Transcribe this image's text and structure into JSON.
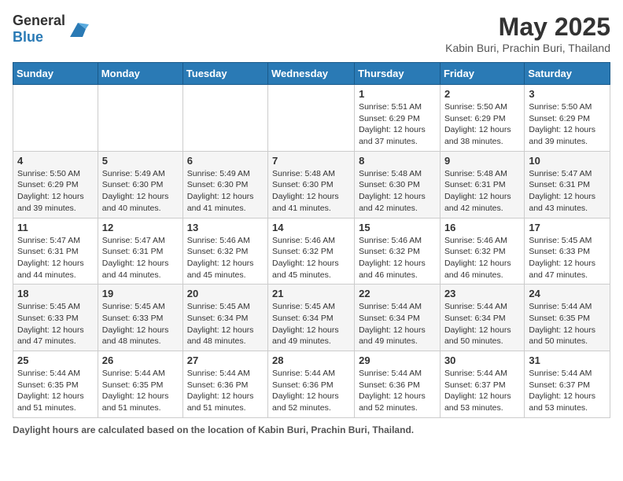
{
  "header": {
    "logo_general": "General",
    "logo_blue": "Blue",
    "title": "May 2025",
    "subtitle": "Kabin Buri, Prachin Buri, Thailand"
  },
  "days_of_week": [
    "Sunday",
    "Monday",
    "Tuesday",
    "Wednesday",
    "Thursday",
    "Friday",
    "Saturday"
  ],
  "weeks": [
    [
      {
        "day": "",
        "info": ""
      },
      {
        "day": "",
        "info": ""
      },
      {
        "day": "",
        "info": ""
      },
      {
        "day": "",
        "info": ""
      },
      {
        "day": "1",
        "info": "Sunrise: 5:51 AM\nSunset: 6:29 PM\nDaylight: 12 hours and 37 minutes."
      },
      {
        "day": "2",
        "info": "Sunrise: 5:50 AM\nSunset: 6:29 PM\nDaylight: 12 hours and 38 minutes."
      },
      {
        "day": "3",
        "info": "Sunrise: 5:50 AM\nSunset: 6:29 PM\nDaylight: 12 hours and 39 minutes."
      }
    ],
    [
      {
        "day": "4",
        "info": "Sunrise: 5:50 AM\nSunset: 6:29 PM\nDaylight: 12 hours and 39 minutes."
      },
      {
        "day": "5",
        "info": "Sunrise: 5:49 AM\nSunset: 6:30 PM\nDaylight: 12 hours and 40 minutes."
      },
      {
        "day": "6",
        "info": "Sunrise: 5:49 AM\nSunset: 6:30 PM\nDaylight: 12 hours and 41 minutes."
      },
      {
        "day": "7",
        "info": "Sunrise: 5:48 AM\nSunset: 6:30 PM\nDaylight: 12 hours and 41 minutes."
      },
      {
        "day": "8",
        "info": "Sunrise: 5:48 AM\nSunset: 6:30 PM\nDaylight: 12 hours and 42 minutes."
      },
      {
        "day": "9",
        "info": "Sunrise: 5:48 AM\nSunset: 6:31 PM\nDaylight: 12 hours and 42 minutes."
      },
      {
        "day": "10",
        "info": "Sunrise: 5:47 AM\nSunset: 6:31 PM\nDaylight: 12 hours and 43 minutes."
      }
    ],
    [
      {
        "day": "11",
        "info": "Sunrise: 5:47 AM\nSunset: 6:31 PM\nDaylight: 12 hours and 44 minutes."
      },
      {
        "day": "12",
        "info": "Sunrise: 5:47 AM\nSunset: 6:31 PM\nDaylight: 12 hours and 44 minutes."
      },
      {
        "day": "13",
        "info": "Sunrise: 5:46 AM\nSunset: 6:32 PM\nDaylight: 12 hours and 45 minutes."
      },
      {
        "day": "14",
        "info": "Sunrise: 5:46 AM\nSunset: 6:32 PM\nDaylight: 12 hours and 45 minutes."
      },
      {
        "day": "15",
        "info": "Sunrise: 5:46 AM\nSunset: 6:32 PM\nDaylight: 12 hours and 46 minutes."
      },
      {
        "day": "16",
        "info": "Sunrise: 5:46 AM\nSunset: 6:32 PM\nDaylight: 12 hours and 46 minutes."
      },
      {
        "day": "17",
        "info": "Sunrise: 5:45 AM\nSunset: 6:33 PM\nDaylight: 12 hours and 47 minutes."
      }
    ],
    [
      {
        "day": "18",
        "info": "Sunrise: 5:45 AM\nSunset: 6:33 PM\nDaylight: 12 hours and 47 minutes."
      },
      {
        "day": "19",
        "info": "Sunrise: 5:45 AM\nSunset: 6:33 PM\nDaylight: 12 hours and 48 minutes."
      },
      {
        "day": "20",
        "info": "Sunrise: 5:45 AM\nSunset: 6:34 PM\nDaylight: 12 hours and 48 minutes."
      },
      {
        "day": "21",
        "info": "Sunrise: 5:45 AM\nSunset: 6:34 PM\nDaylight: 12 hours and 49 minutes."
      },
      {
        "day": "22",
        "info": "Sunrise: 5:44 AM\nSunset: 6:34 PM\nDaylight: 12 hours and 49 minutes."
      },
      {
        "day": "23",
        "info": "Sunrise: 5:44 AM\nSunset: 6:34 PM\nDaylight: 12 hours and 50 minutes."
      },
      {
        "day": "24",
        "info": "Sunrise: 5:44 AM\nSunset: 6:35 PM\nDaylight: 12 hours and 50 minutes."
      }
    ],
    [
      {
        "day": "25",
        "info": "Sunrise: 5:44 AM\nSunset: 6:35 PM\nDaylight: 12 hours and 51 minutes."
      },
      {
        "day": "26",
        "info": "Sunrise: 5:44 AM\nSunset: 6:35 PM\nDaylight: 12 hours and 51 minutes."
      },
      {
        "day": "27",
        "info": "Sunrise: 5:44 AM\nSunset: 6:36 PM\nDaylight: 12 hours and 51 minutes."
      },
      {
        "day": "28",
        "info": "Sunrise: 5:44 AM\nSunset: 6:36 PM\nDaylight: 12 hours and 52 minutes."
      },
      {
        "day": "29",
        "info": "Sunrise: 5:44 AM\nSunset: 6:36 PM\nDaylight: 12 hours and 52 minutes."
      },
      {
        "day": "30",
        "info": "Sunrise: 5:44 AM\nSunset: 6:37 PM\nDaylight: 12 hours and 53 minutes."
      },
      {
        "day": "31",
        "info": "Sunrise: 5:44 AM\nSunset: 6:37 PM\nDaylight: 12 hours and 53 minutes."
      }
    ]
  ],
  "footer": {
    "label": "Daylight hours",
    "description": "are calculated based on the location of Kabin Buri, Prachin Buri, Thailand."
  }
}
